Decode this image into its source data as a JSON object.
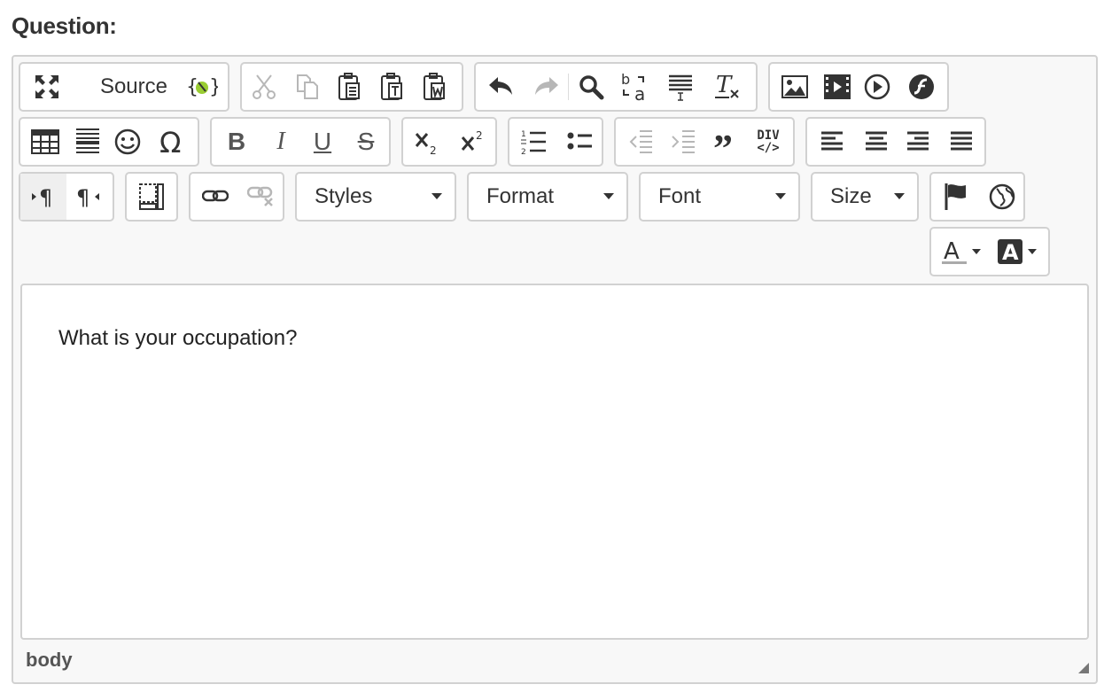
{
  "question_label": "Question:",
  "toolbar": {
    "source_label": "Source",
    "styles_label": "Styles",
    "format_label": "Format",
    "font_label": "Font",
    "size_label": "Size",
    "bold_label": "B",
    "italic_label": "I",
    "underline_label": "U",
    "strike_label": "S",
    "div_label_top": "DIV",
    "div_label_bottom": "</>"
  },
  "content": {
    "text": "What is your occupation?"
  },
  "status": {
    "path": "body"
  },
  "colors": {
    "border": "#d1d1d1",
    "toolbar_bg": "#f8f8f8",
    "icon": "#444444"
  },
  "icons": [
    "maximize-icon",
    "source-icon",
    "sourcedialog-icon",
    "cut-icon",
    "copy-icon",
    "paste-icon",
    "paste-text-icon",
    "paste-word-icon",
    "undo-icon",
    "redo-icon",
    "find-icon",
    "replace-icon",
    "select-all-icon",
    "remove-format-icon",
    "image-icon",
    "video-icon",
    "embed-icon",
    "flash-icon",
    "table-icon",
    "horizontal-rule-icon",
    "smiley-icon",
    "special-char-icon",
    "subscript-icon",
    "superscript-icon",
    "numbered-list-icon",
    "bulleted-list-icon",
    "outdent-icon",
    "indent-icon",
    "blockquote-icon",
    "div-icon",
    "align-left-icon",
    "align-center-icon",
    "align-right-icon",
    "justify-icon",
    "ltr-icon",
    "rtl-icon",
    "show-blocks-icon",
    "link-icon",
    "unlink-icon",
    "anchor-flag-icon",
    "language-icon",
    "text-color-icon",
    "bg-color-icon"
  ]
}
